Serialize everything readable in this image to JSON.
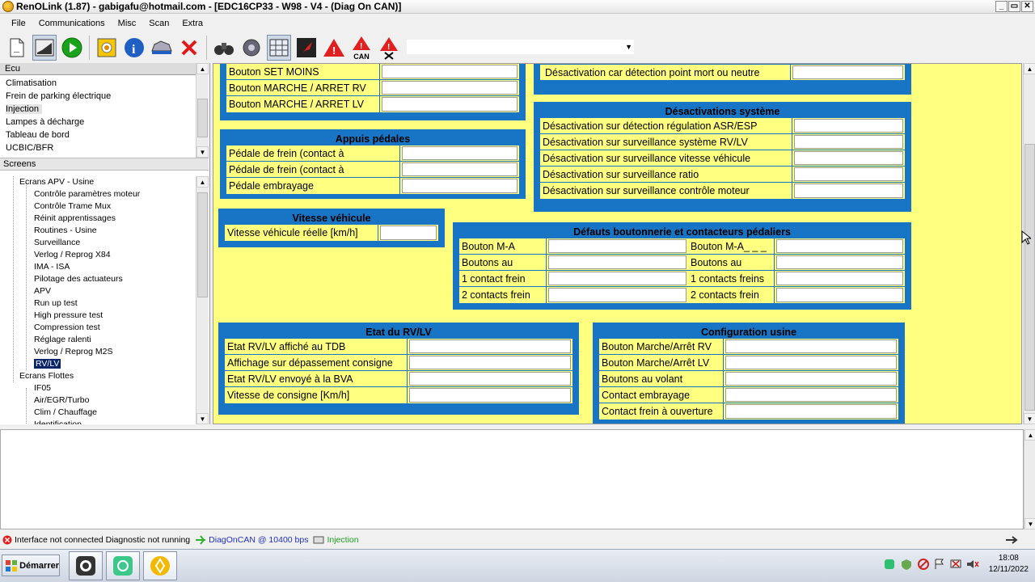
{
  "window": {
    "title": "RenOLink (1.87) - gabigafu@hotmail.com - [EDC16CP33 - W98 - V4 - (Diag On CAN)]",
    "buttons": [
      "_",
      "▭",
      "✕"
    ]
  },
  "menu": [
    "File",
    "Communications",
    "Misc",
    "Scan",
    "Extra"
  ],
  "toolbar": {
    "can_label": "CAN",
    "combo_value": ""
  },
  "left": {
    "ecu_header": "Ecu",
    "ecu_items": [
      "Climatisation",
      "Frein de parking électrique",
      "Injection",
      "Lampes à décharge",
      "Tableau de bord",
      "UCBIC/BFR"
    ],
    "selected_ecu": "Injection",
    "screens_header": "Screens",
    "tree": [
      {
        "label": "Ecrans APV - Usine",
        "level": 0
      },
      {
        "label": "Contrôle paramètres moteur",
        "level": 1
      },
      {
        "label": "Contrôle Trame Mux",
        "level": 1
      },
      {
        "label": "Réinit apprentissages",
        "level": 1
      },
      {
        "label": "Routines - Usine",
        "level": 1
      },
      {
        "label": "Surveillance",
        "level": 1
      },
      {
        "label": "Verlog / Reprog X84",
        "level": 1
      },
      {
        "label": "IMA - ISA",
        "level": 1
      },
      {
        "label": "Pilotage des actuateurs",
        "level": 1
      },
      {
        "label": "APV",
        "level": 1
      },
      {
        "label": "Run up test",
        "level": 1
      },
      {
        "label": "High pressure test",
        "level": 1
      },
      {
        "label": "Compression test",
        "level": 1
      },
      {
        "label": "Réglage ralenti",
        "level": 1
      },
      {
        "label": "Verlog / Reprog M2S",
        "level": 1
      },
      {
        "label": "RV/LV",
        "level": 1,
        "selected": true
      },
      {
        "label": "Ecrans Flottes",
        "level": 0
      },
      {
        "label": "IF05",
        "level": 1
      },
      {
        "label": "Air/EGR/Turbo",
        "level": 1
      },
      {
        "label": "Clim / Chauffage",
        "level": 1
      },
      {
        "label": "Identification",
        "level": 1
      }
    ]
  },
  "main": {
    "top_left_rows": [
      "Bouton SET MOINS",
      "Bouton MARCHE / ARRET RV",
      "Bouton MARCHE / ARRET LV"
    ],
    "top_right_row": "Désactivation car détection point mort ou neutre",
    "appuis": {
      "title": "Appuis pédales",
      "rows": [
        "Pédale de frein (contact à",
        "Pédale de frein (contact à",
        "Pédale embrayage"
      ]
    },
    "desactivations": {
      "title": "Désactivations système",
      "rows": [
        "Désactivation sur détection régulation ASR/ESP",
        "Désactivation sur surveillance système RV/LV",
        "Désactivation sur surveillance vitesse véhicule",
        "Désactivation sur surveillance ratio",
        "Désactivation sur surveillance contrôle moteur"
      ]
    },
    "vitesse": {
      "title": "Vitesse véhicule",
      "rows": [
        "Vitesse véhicule réelle [km/h]"
      ]
    },
    "defauts": {
      "title": "Défauts boutonnerie et contacteurs pédaliers",
      "left_rows": [
        "Bouton M-A",
        "Boutons au",
        "1 contact frein",
        "2 contacts frein"
      ],
      "right_rows": [
        "Bouton M-A_ _ _",
        "Boutons au",
        "1 contacts freins",
        "2 contacts frein"
      ]
    },
    "etat": {
      "title": "Etat du RV/LV",
      "rows": [
        "Etat RV/LV affiché au TDB",
        "Affichage sur dépassement consigne",
        "Etat RV/LV envoyé à la BVA",
        "Vitesse de consigne [Km/h]"
      ]
    },
    "config": {
      "title": "Configuration usine",
      "rows": [
        "Bouton Marche/Arrêt RV",
        "Bouton Marche/Arrêt LV",
        "Boutons au volant",
        "Contact embrayage",
        "Contact frein à ouverture"
      ]
    }
  },
  "status": {
    "interface": "Interface not connected Diagnostic not running",
    "protocol": "DiagOnCAN @ 10400 bps",
    "ecu": "Injection"
  },
  "taskbar": {
    "start_label": "Démarrer",
    "time": "18:08",
    "date": "12/11/2022"
  },
  "colors": {
    "panel_blue": "#1874c4",
    "panel_yellow": "#ffff80",
    "selection": "#0a246a"
  }
}
